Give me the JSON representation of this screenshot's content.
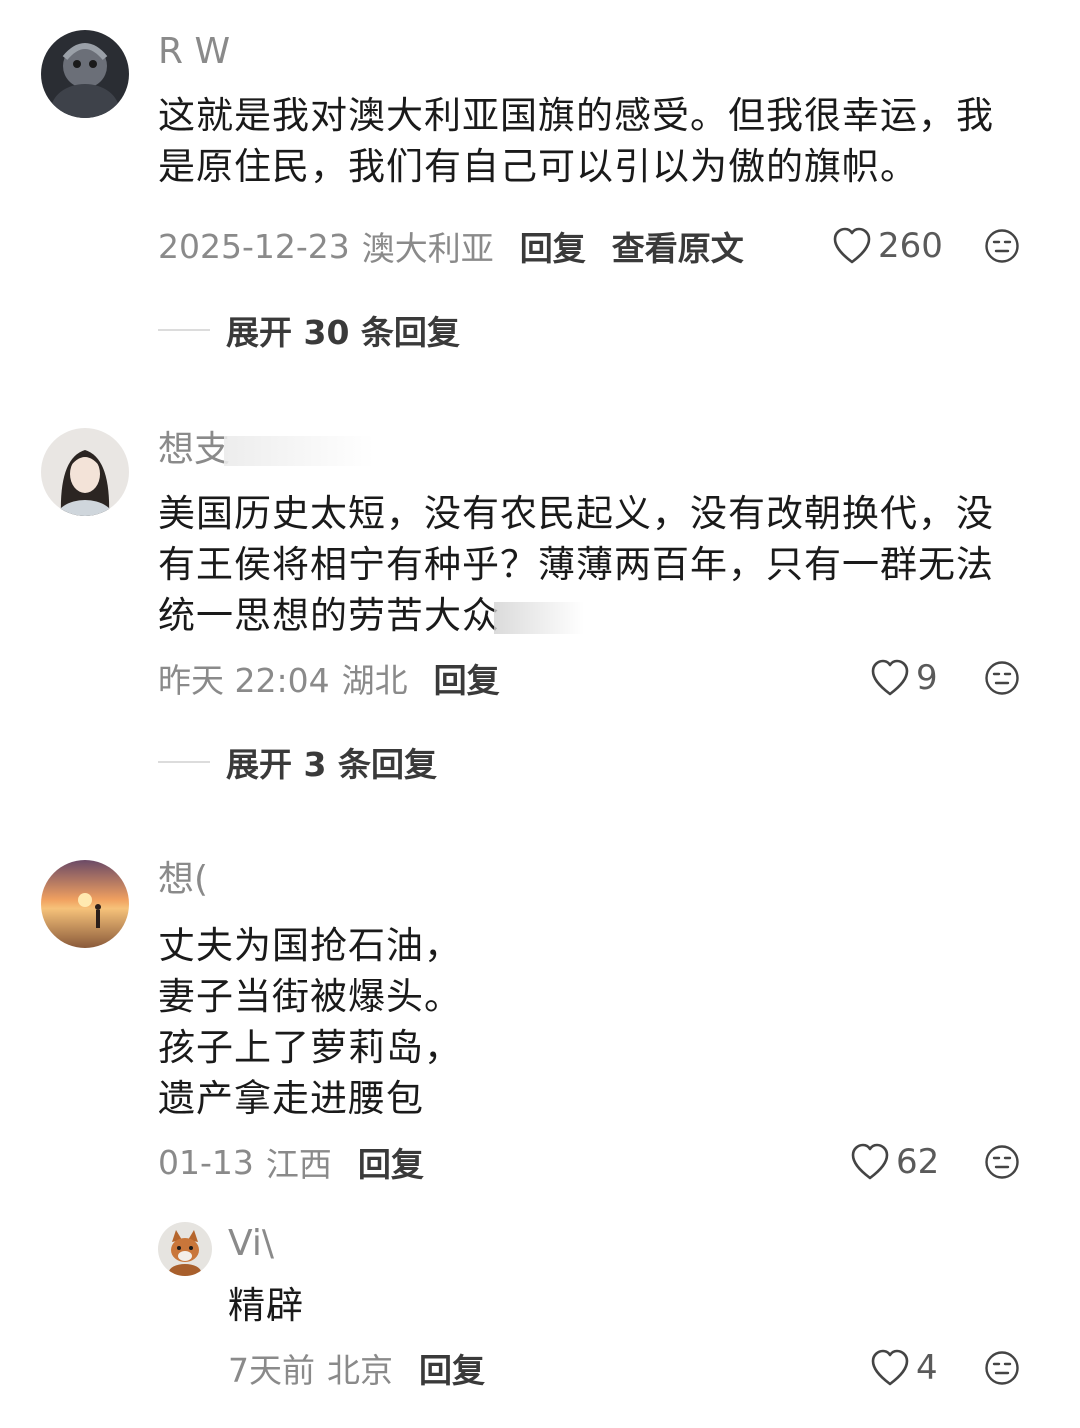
{
  "comments": [
    {
      "username": "R W",
      "text_lines": [
        "这就是我对澳大利亚国旗的感受。但我很幸运，我",
        "是原住民，我们有自己可以引以为傲的旗帜。"
      ],
      "date": "2025-12-23",
      "location": "澳大利亚",
      "reply_label": "回复",
      "view_original_label": "查看原文",
      "likes": "260",
      "expand_label": "展开 30 条回复"
    },
    {
      "username": "想支",
      "text_lines": [
        "美国历史太短，没有农民起义，没有改朝换代，没",
        "有王侯将相宁有种乎？薄薄两百年，只有一群无法",
        "统一思想的劳苦大众"
      ],
      "date": "昨天 22:04",
      "location": "湖北",
      "reply_label": "回复",
      "likes": "9",
      "expand_label": "展开 3 条回复"
    },
    {
      "username": "想(",
      "text_lines": [
        "丈夫为国抢石油，",
        "妻子当街被爆头。",
        "孩子上了萝莉岛，",
        "遗产拿走进腰包"
      ],
      "date": "01-13",
      "location": "江西",
      "reply_label": "回复",
      "likes": "62"
    }
  ],
  "reply": {
    "username": "Vi\\",
    "text": "精辟",
    "date": "7天前",
    "location": "北京",
    "reply_label": "回复",
    "likes": "4"
  },
  "icons": {
    "like": "heart-outline-icon",
    "reaction": "face-icon"
  }
}
